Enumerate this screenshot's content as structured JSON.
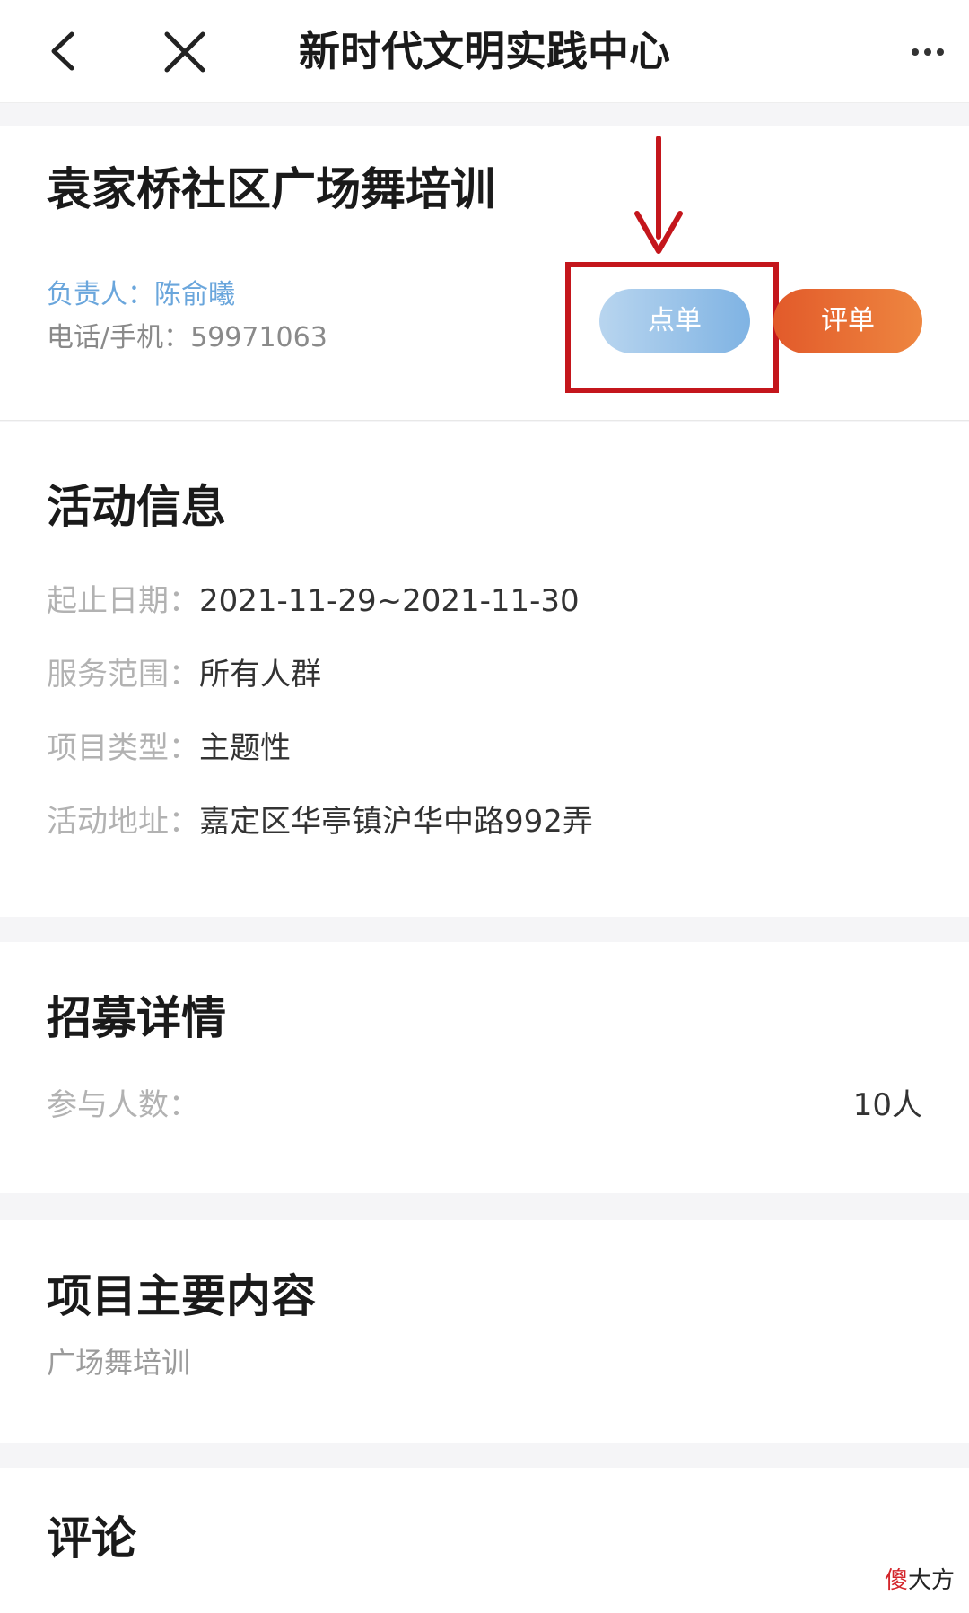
{
  "nav": {
    "title": "新时代文明实践中心"
  },
  "activity": {
    "title": "袁家桥社区广场舞培训",
    "leader_label": "负责人：",
    "leader_name": "陈俞曦",
    "phone_label": "电话/手机：",
    "phone": "59971063",
    "order_label": "点单",
    "rate_label": "评单"
  },
  "info": {
    "heading": "活动信息",
    "rows": [
      {
        "label": "起止日期：",
        "value": "2021-11-29~2021-11-30"
      },
      {
        "label": "服务范围：",
        "value": "所有人群"
      },
      {
        "label": "项目类型：",
        "value": "主题性"
      },
      {
        "label": "活动地址：",
        "value": "嘉定区华亭镇沪华中路992弄"
      }
    ]
  },
  "recruit": {
    "heading": "招募详情",
    "count_label": "参与人数：",
    "count_value": "10人"
  },
  "content": {
    "heading": "项目主要内容",
    "text": "广场舞培训"
  },
  "comments": {
    "heading": "评论"
  },
  "watermark": {
    "part1": "傻",
    "part2": "大方"
  },
  "colors": {
    "order_button": "#8dbde6",
    "rate_button": "#e8672e",
    "highlight": "#c4161c",
    "leader_text": "#6aa6dc"
  },
  "icons": {
    "back": "chevron-left-icon",
    "close": "close-icon",
    "more": "more-dots-icon",
    "annotation": "down-arrow-icon"
  }
}
